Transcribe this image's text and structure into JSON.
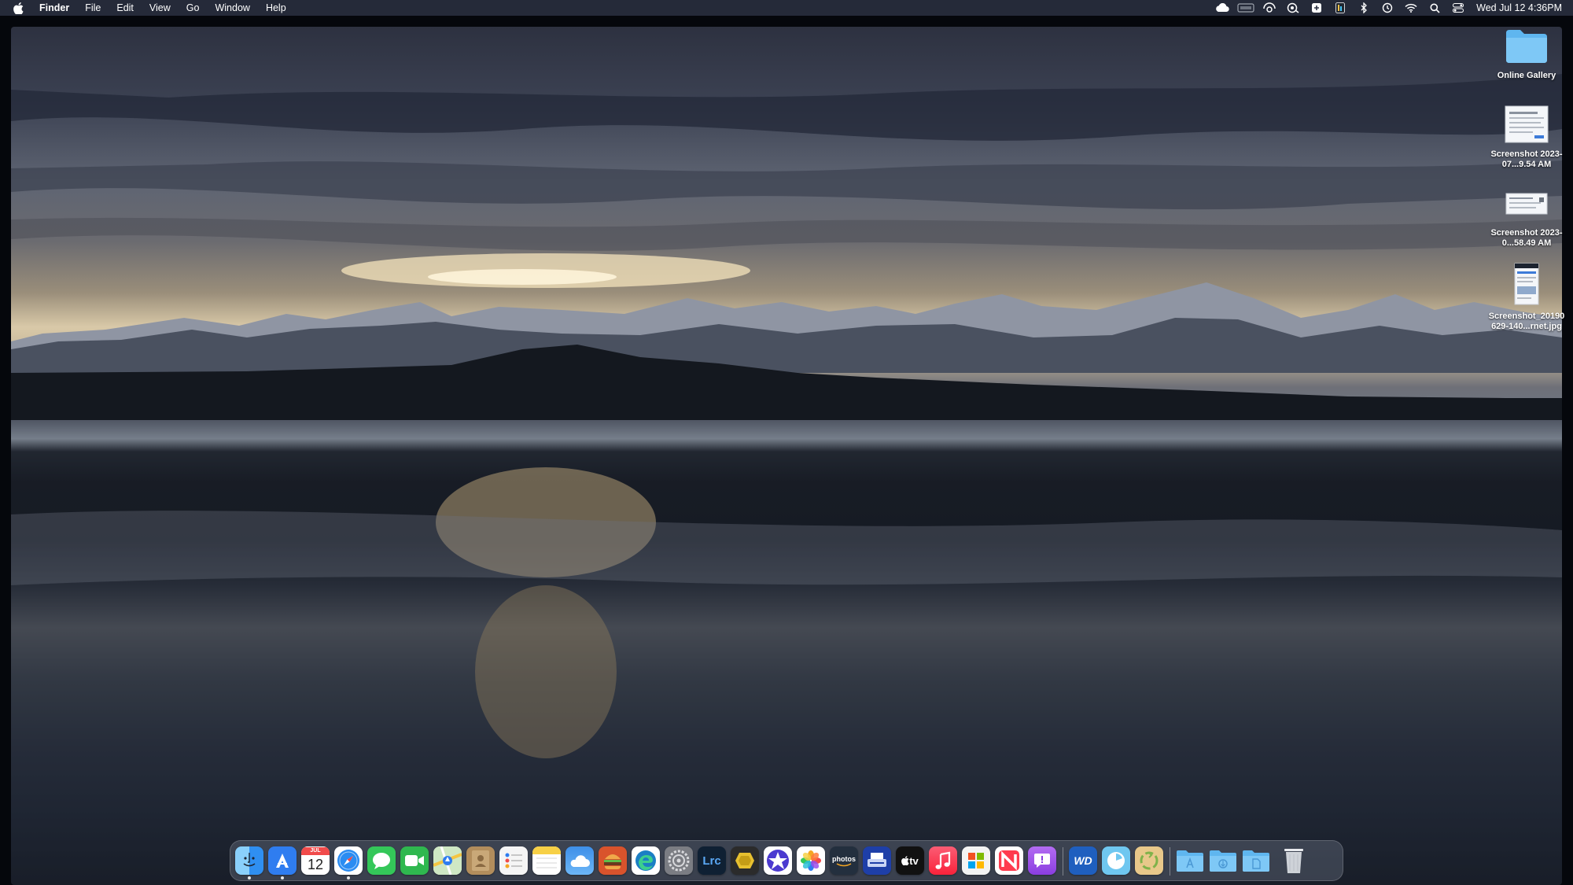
{
  "menubar": {
    "app_name": "Finder",
    "menus": [
      "File",
      "Edit",
      "View",
      "Go",
      "Window",
      "Help"
    ],
    "clock": "Wed Jul 12  4:36PM",
    "status_icons": [
      "icloud-icon",
      "display-badge-icon",
      "sync-eye-icon",
      "cloud-eye-icon",
      "share-icon",
      "color-app-icon",
      "bluetooth-icon",
      "time-machine-icon",
      "wifi-icon",
      "spotlight-icon",
      "control-center-icon"
    ]
  },
  "desktop": {
    "icons": [
      {
        "name": "online-gallery-folder",
        "label": "Online Gallery",
        "kind": "folder"
      },
      {
        "name": "screenshot-1",
        "label": "Screenshot 2023-07...9.54 AM",
        "kind": "doc"
      },
      {
        "name": "screenshot-2",
        "label": "Screenshot 2023-0...58.49 AM",
        "kind": "doc-wide"
      },
      {
        "name": "screenshot-3",
        "label": "Screenshot_20190 629-140...rnet.jpg",
        "kind": "doc-tall"
      }
    ]
  },
  "dock": {
    "apps": [
      {
        "name": "finder",
        "label": "",
        "color": "#3ba0f6",
        "running": true
      },
      {
        "name": "app-store-launcher",
        "label": "",
        "color": "#2f7df0",
        "running": true
      },
      {
        "name": "calendar",
        "label": "12",
        "color": "#ffffff",
        "running": false
      },
      {
        "name": "safari",
        "label": "",
        "color": "#2a8cf2",
        "running": true
      },
      {
        "name": "messages",
        "label": "",
        "color": "#34c759",
        "running": false
      },
      {
        "name": "facetime",
        "label": "",
        "color": "#2fb84f",
        "running": false
      },
      {
        "name": "maps",
        "label": "",
        "color": "#6cc96b",
        "running": false
      },
      {
        "name": "contacts",
        "label": "",
        "color": "#b28d5c",
        "running": false
      },
      {
        "name": "reminders",
        "label": "",
        "color": "#f5f5f5",
        "running": false
      },
      {
        "name": "notes",
        "label": "",
        "color": "#f7d046",
        "running": false
      },
      {
        "name": "weather",
        "label": "",
        "color": "#4a90e2",
        "running": false
      },
      {
        "name": "burger-app",
        "label": "",
        "color": "#d9532c",
        "running": false
      },
      {
        "name": "edge",
        "label": "",
        "color": "#1b7fc4",
        "running": false
      },
      {
        "name": "system-settings",
        "label": "",
        "color": "#7b7d83",
        "running": false
      },
      {
        "name": "lightroom-classic",
        "label": "Lrc",
        "color": "#0f2033",
        "running": false
      },
      {
        "name": "photo-app-yellow",
        "label": "",
        "color": "#2b2b2b",
        "running": false
      },
      {
        "name": "imovie",
        "label": "",
        "color": "#4b3ad0",
        "running": false
      },
      {
        "name": "photos",
        "label": "",
        "color": "#f0f0f0",
        "running": false
      },
      {
        "name": "amazon-photos",
        "label": "photos",
        "color": "#232f3e",
        "running": false
      },
      {
        "name": "scanner-app",
        "label": "",
        "color": "#1e3fa8",
        "running": false
      },
      {
        "name": "apple-tv",
        "label": "tv",
        "color": "#111111",
        "running": false
      },
      {
        "name": "music",
        "label": "",
        "color": "#fa3e55",
        "running": false
      },
      {
        "name": "microsoft-remote",
        "label": "",
        "color": "#f3f3f3",
        "running": false
      },
      {
        "name": "news",
        "label": "",
        "color": "#ff3b4e",
        "running": false
      },
      {
        "name": "feedback",
        "label": "",
        "color": "#9b4dea",
        "running": false
      },
      {
        "name": "wd-discovery",
        "label": "WD",
        "color": "#1f5fbf",
        "running": false
      },
      {
        "name": "timer-app",
        "label": "",
        "color": "#6fc7f0",
        "running": false
      },
      {
        "name": "recycle-app",
        "label": "",
        "color": "#e8c88a",
        "running": false
      }
    ],
    "folders": [
      {
        "name": "applications-folder"
      },
      {
        "name": "downloads-folder"
      },
      {
        "name": "documents-folder"
      }
    ],
    "trash_label": ""
  }
}
